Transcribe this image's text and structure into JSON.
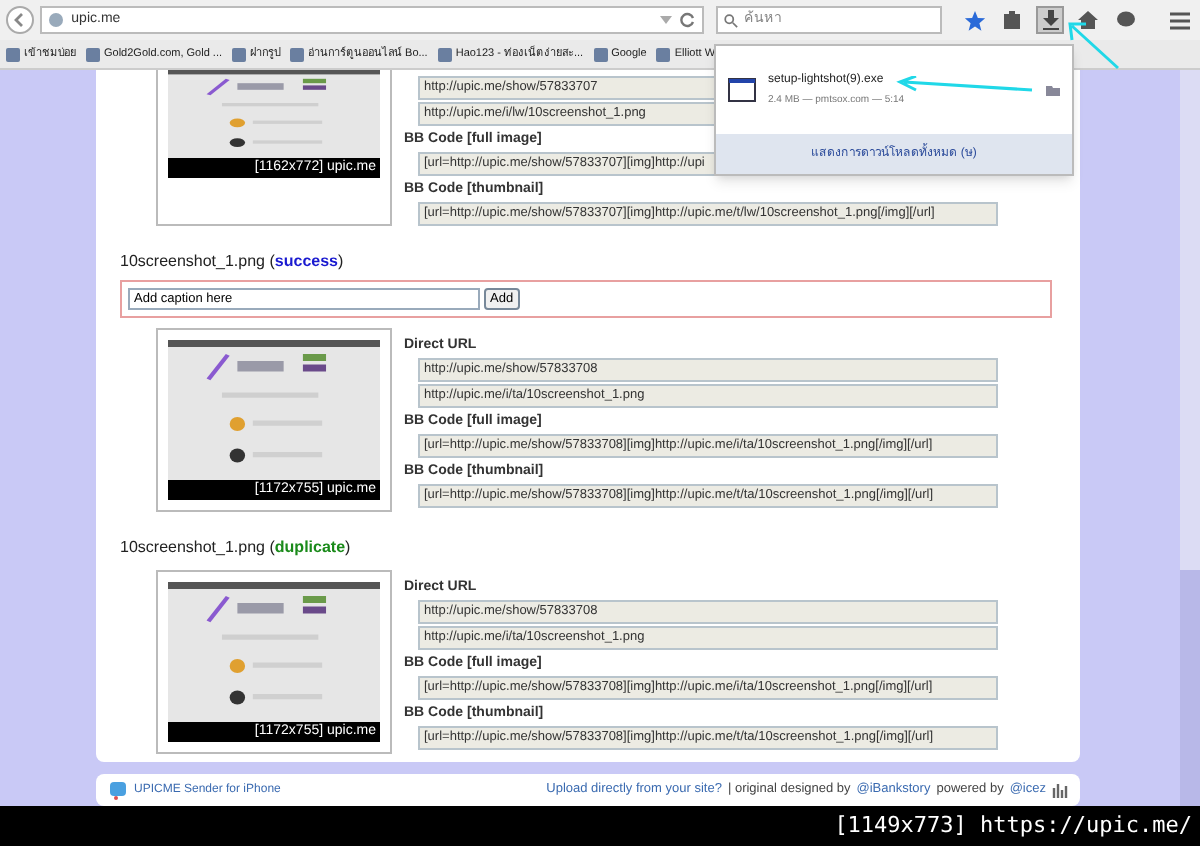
{
  "toolbar": {
    "url": "upic.me",
    "search": {
      "placeholder": "ค้นหา"
    }
  },
  "bookmarks": [
    "เข้าชมบ่อย",
    "Gold2Gold.com, Gold ...",
    "ฝากรูป",
    "อ่านการ์ตูนออนไลน์ Bo...",
    "Hao123 - ท่องเน็ตง่ายสะ...",
    "Google",
    "Elliott W"
  ],
  "downloads_panel": {
    "file": "setup-lightshot(9).exe",
    "details": "2.4 MB — pmtsox.com — 5:14",
    "show_all": "แสดงการดาวน์โหลดทั้งหมด (ษ)"
  },
  "top_section": {
    "thumbnail_caption": "[1162x772] upic.me",
    "rows": [
      {
        "kind": "field",
        "text": "http://upic.me/show/57833707"
      },
      {
        "kind": "field",
        "text": "http://upic.me/i/lw/10screenshot_1.png"
      },
      {
        "kind": "label",
        "text": "BB Code [full image]"
      },
      {
        "kind": "field",
        "text": "[url=http://upic.me/show/57833707][img]http://upi"
      },
      {
        "kind": "label",
        "text": "BB Code [thumbnail]"
      },
      {
        "kind": "field",
        "text": "[url=http://upic.me/show/57833707][img]http://upic.me/t/lw/10screenshot_1.png[/img][/url]"
      }
    ]
  },
  "sections": [
    {
      "filename": "10screenshot_1.png",
      "open": "(",
      "status": "success",
      "close": ")",
      "color": "#1a1ad0",
      "caption": {
        "value": "Add caption here",
        "button": "Add"
      },
      "thumbnail_caption": "[1172x755] upic.me",
      "rows": [
        {
          "kind": "label",
          "text": "Direct URL"
        },
        {
          "kind": "field",
          "text": "http://upic.me/show/57833708"
        },
        {
          "kind": "field",
          "text": "http://upic.me/i/ta/10screenshot_1.png"
        },
        {
          "kind": "label",
          "text": "BB Code [full image]"
        },
        {
          "kind": "field",
          "text": "[url=http://upic.me/show/57833708][img]http://upic.me/i/ta/10screenshot_1.png[/img][/url]"
        },
        {
          "kind": "label",
          "text": "BB Code [thumbnail]"
        },
        {
          "kind": "field",
          "text": "[url=http://upic.me/show/57833708][img]http://upic.me/t/ta/10screenshot_1.png[/img][/url]"
        }
      ]
    },
    {
      "filename": "10screenshot_1.png",
      "open": "(",
      "status": "duplicate",
      "close": ")",
      "color": "#1a8a1a",
      "thumbnail_caption": "[1172x755] upic.me",
      "rows": [
        {
          "kind": "label",
          "text": "Direct URL"
        },
        {
          "kind": "field",
          "text": "http://upic.me/show/57833708"
        },
        {
          "kind": "field",
          "text": "http://upic.me/i/ta/10screenshot_1.png"
        },
        {
          "kind": "label",
          "text": "BB Code [full image]"
        },
        {
          "kind": "field",
          "text": "[url=http://upic.me/show/57833708][img]http://upic.me/i/ta/10screenshot_1.png[/img][/url]"
        },
        {
          "kind": "label",
          "text": "BB Code [thumbnail]"
        },
        {
          "kind": "field",
          "text": "[url=http://upic.me/show/57833708][img]http://upic.me/t/ta/10screenshot_1.png[/img][/url]"
        }
      ]
    }
  ],
  "footer": {
    "app_link": "UPICME Sender for iPhone",
    "upload_link": "Upload directly from your site?",
    "designed": "| original designed by",
    "designer": "@iBankstory",
    "powered": "powered by",
    "powered_by": "@icez"
  },
  "screenshot_caption": "[1149x773] https://upic.me/"
}
